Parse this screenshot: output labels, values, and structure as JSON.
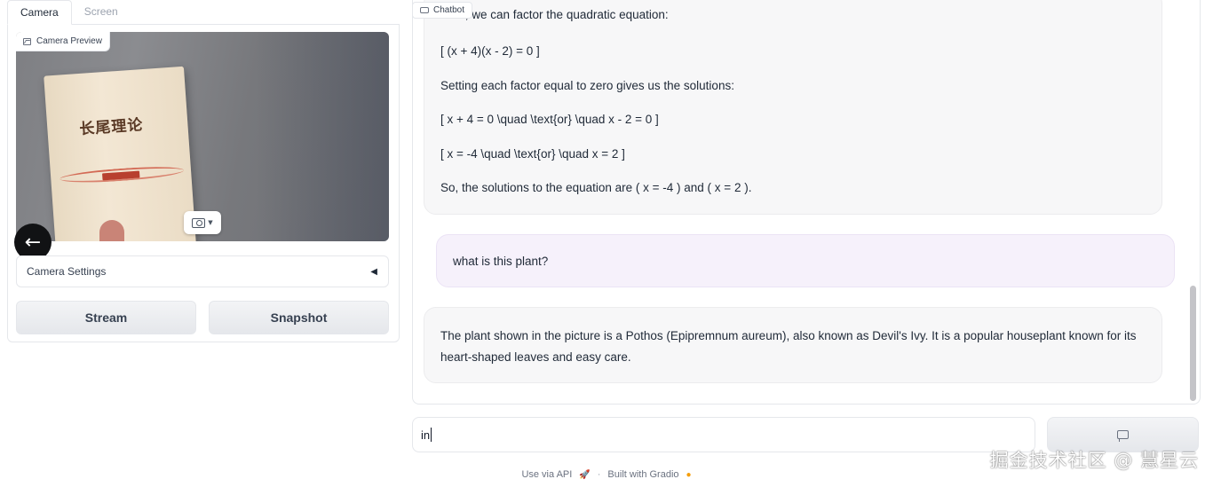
{
  "tabs": [
    {
      "label": "Camera",
      "active": true
    },
    {
      "label": "Screen",
      "active": false
    }
  ],
  "camera": {
    "preview_label": "Camera Preview",
    "book_title": "长尾理论",
    "settings_label": "Camera Settings",
    "settings_toggle": "◀",
    "back_arrow": "←",
    "stream_label": "Stream",
    "snapshot_label": "Snapshot"
  },
  "chatbot": {
    "label": "Chatbot",
    "bot_message_1": {
      "cut_line": "Next, we can factor the quadratic equation:",
      "lines": [
        "[ (x + 4)(x - 2) = 0 ]",
        "Setting each factor equal to zero gives us the solutions:",
        "[ x + 4 = 0 \\quad \\text{or} \\quad x - 2 = 0 ]",
        "[ x = -4 \\quad \\text{or} \\quad x = 2 ]",
        "So, the solutions to the equation are ( x = -4 ) and ( x = 2 )."
      ]
    },
    "user_message_1": "what is this plant?",
    "bot_message_2": "The plant shown in the picture is a Pothos (Epipremnum aureum), also known as Devil's Ivy. It is a popular houseplant known for its heart-shaped leaves and easy care."
  },
  "input": {
    "value": "in"
  },
  "footer": {
    "api_label": "Use via API",
    "separator": "·",
    "built_label": "Built with Gradio"
  },
  "watermark": "掘金技术社区 @ 慧星云",
  "icons": {
    "preview": "image-icon",
    "camera": "camera-icon",
    "chatbot": "chat-icon",
    "send": "message-icon",
    "api": "rocket-icon",
    "gradio": "gradio-logo-icon"
  }
}
